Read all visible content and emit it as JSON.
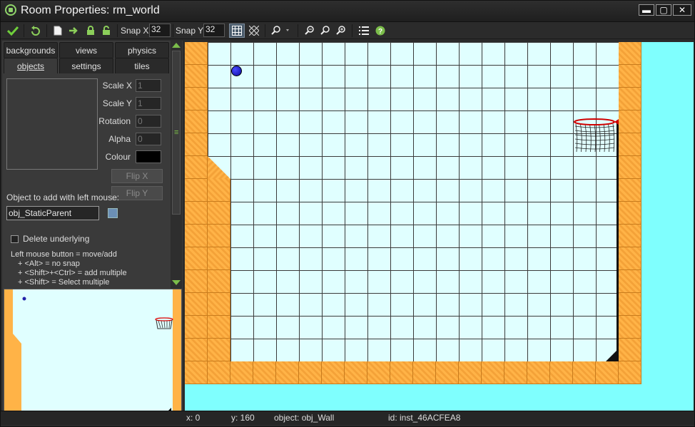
{
  "window": {
    "title": "Room Properties: rm_world"
  },
  "title_buttons": {
    "minimize": "▬",
    "maximize": "▢",
    "close": "✕"
  },
  "toolbar": {
    "snap_x_label": "Snap X:",
    "snap_x_value": "32",
    "snap_y_label": "Snap Y:",
    "snap_y_value": "32",
    "accent_color": "#7bbd4a"
  },
  "tabs": {
    "row1": [
      "backgrounds",
      "views",
      "physics"
    ],
    "row2": [
      "objects",
      "settings",
      "tiles"
    ],
    "active": "objects"
  },
  "objects_panel": {
    "scale_x_label": "Scale X",
    "scale_x_value": "1",
    "scale_y_label": "Scale Y",
    "scale_y_value": "1",
    "rotation_label": "Rotation",
    "rotation_value": "0",
    "alpha_label": "Alpha",
    "alpha_value": "0",
    "colour_label": "Colour",
    "colour_value": "#000000",
    "flip_x_label": "Flip X",
    "flip_y_label": "Flip Y",
    "object_add_label": "Object to add with left mouse:",
    "object_value": "obj_StaticParent",
    "delete_underlying_label": "Delete underlying",
    "delete_underlying_checked": false,
    "help_lines": [
      "Left mouse button = move/add",
      "+ <Alt> = no snap",
      "+ <Shift>+<Ctrl> = add multiple",
      "+ <Shift> = Select multiple"
    ]
  },
  "room": {
    "background_color": "#e0ffff",
    "outer_color": "#7ffffe",
    "wall_color": "#ffb347",
    "grid_color": "#3b3b3b"
  },
  "status": {
    "x": "x: 0",
    "y": "y: 160",
    "object": "object: obj_Wall",
    "id": "id: inst_46ACFEA8"
  }
}
